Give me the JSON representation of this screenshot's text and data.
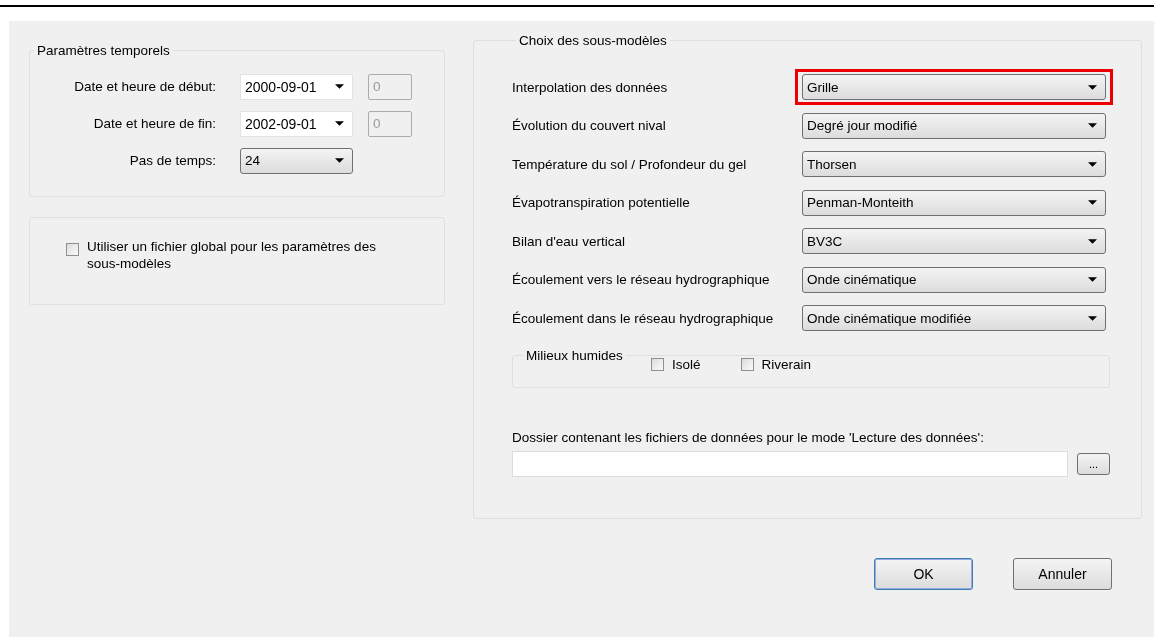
{
  "time_params": {
    "title": "Paramètres temporels",
    "rows": [
      {
        "kind": "datetime",
        "label": "Date et heure de début:",
        "value": "2000-09-01",
        "hour": "0",
        "hour_disabled": true
      },
      {
        "kind": "datetime",
        "label": "Date et heure de fin:",
        "value": "2002-09-01",
        "hour": "0",
        "hour_disabled": true
      },
      {
        "kind": "dropdown",
        "label": "Pas de temps:",
        "value": "24"
      }
    ]
  },
  "global_file": {
    "label": "Utiliser un fichier global pour les paramètres des sous-modèles",
    "checked": false
  },
  "submodels": {
    "title": "Choix des sous-modèles",
    "rows": [
      {
        "label": "Interpolation des données",
        "value": "Grille",
        "highlighted": true
      },
      {
        "label": "Évolution du couvert nival",
        "value": "Degré jour modifié",
        "highlighted": false
      },
      {
        "label": "Température du sol / Profondeur du gel",
        "value": "Thorsen",
        "highlighted": false
      },
      {
        "label": "Évapotranspiration potentielle",
        "value": "Penman-Monteith",
        "highlighted": false
      },
      {
        "label": "Bilan d'eau vertical",
        "value": "BV3C",
        "highlighted": false
      },
      {
        "label": "Écoulement vers le réseau hydrographique",
        "value": "Onde cinématique",
        "highlighted": false
      },
      {
        "label": "Écoulement dans le réseau hydrographique",
        "value": "Onde cinématique modifiée",
        "highlighted": false
      }
    ],
    "wetlands": {
      "title": "Milieux humides",
      "options": [
        {
          "label": "Isolé",
          "checked": false
        },
        {
          "label": "Riverain",
          "checked": false
        }
      ]
    },
    "folder": {
      "label": "Dossier contenant les fichiers de données pour le mode 'Lecture des données':",
      "browse": "..."
    }
  },
  "buttons": [
    {
      "label": "OK",
      "default": true
    },
    {
      "label": "Annuler",
      "default": false
    }
  ]
}
